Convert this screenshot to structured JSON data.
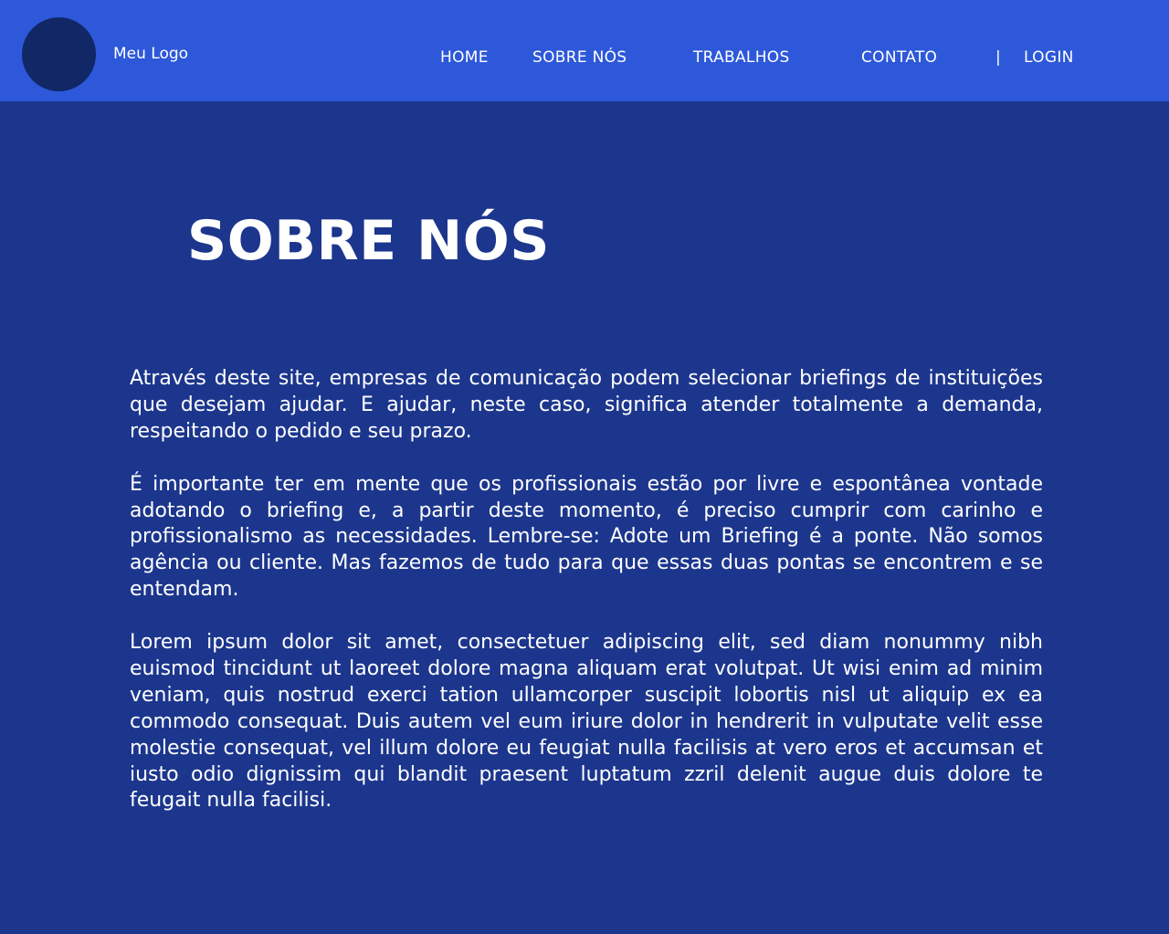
{
  "header": {
    "logo_text": "Meu Logo",
    "nav": {
      "home": "HOME",
      "sobre": "SOBRE NÓS",
      "trabalhos": "TRABALHOS",
      "contato": "CONTATO",
      "separator": "|",
      "login": "LOGIN"
    }
  },
  "main": {
    "title": "SOBRE NÓS",
    "paragraphs": [
      "Através deste site, empresas de comunicação podem selecionar briefings de instituições que desejam ajudar. E ajudar, neste caso, significa atender totalmente a demanda, respeitando o pedido e seu prazo.",
      "É importante ter em mente que os profissionais estão por livre e espontânea vontade adotando o briefing e, a partir deste momento, é preciso cumprir com carinho e profissionalismo as necessidades. Lembre-se: Adote um Briefing é a ponte. Não somos agência ou cliente. Mas fazemos de tudo para que essas duas pontas se encontrem e se entendam.",
      "Lorem ipsum dolor sit amet, consectetuer adipiscing elit, sed diam nonummy nibh euismod tincidunt ut laoreet dolore magna aliquam erat volutpat. Ut wisi enim ad minim veniam, quis nostrud exerci tation ullamcorper suscipit lobortis nisl ut aliquip ex ea commodo consequat. Duis autem vel eum iriure dolor in hendrerit in vulputate velit esse molestie consequat, vel illum dolore eu feugiat nulla facilisis at vero eros et accumsan et iusto odio dignissim qui blandit praesent luptatum zzril delenit augue duis dolore te feugait nulla facilisi."
    ]
  },
  "colors": {
    "page_background": "#1c368d",
    "navbar_background": "#2d58d9",
    "logo_circle": "#112766",
    "text": "#ffffff"
  }
}
